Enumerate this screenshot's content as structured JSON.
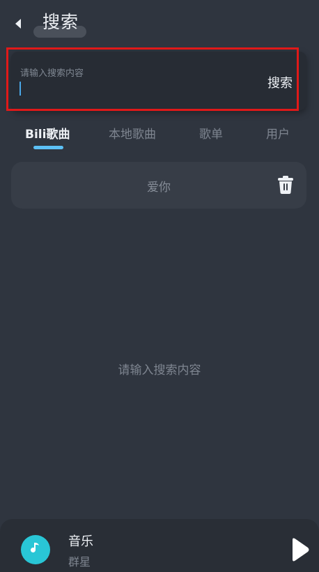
{
  "header": {
    "title": "搜索"
  },
  "search": {
    "placeholder": "请输入搜索内容",
    "value": "",
    "button_label": "搜索"
  },
  "tabs": [
    {
      "label": "Bili歌曲",
      "active": true
    },
    {
      "label": "本地歌曲",
      "active": false
    },
    {
      "label": "歌单",
      "active": false
    },
    {
      "label": "用户",
      "active": false
    }
  ],
  "history": {
    "items": [
      {
        "text": "爱你"
      }
    ]
  },
  "empty_hint": "请输入搜索内容",
  "player": {
    "title": "音乐",
    "artist": "群星"
  },
  "colors": {
    "background": "#2f353f",
    "accent": "#5cc0f5",
    "cover": "#29c6d6",
    "highlight_border": "#e01919"
  }
}
